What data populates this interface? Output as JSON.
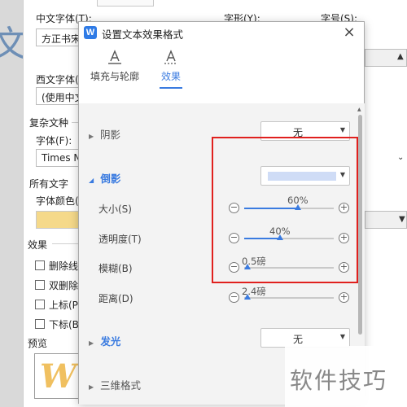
{
  "background_dialog": {
    "chinese_font_label": "中文字体(T):",
    "chinese_font_value": "方正书宋",
    "style_label": "字形(Y):",
    "size_label": "字号(S):",
    "western_font_label": "西文字体(X):",
    "western_font_value": "(使用中文",
    "complex_script_label": "复杂文种",
    "font_label": "字体(F):",
    "font_value": "Times N",
    "all_text_label": "所有文字",
    "font_color_label": "字体颜色(",
    "effects_label": "效果",
    "effects": [
      "删除线",
      "双删除",
      "上标(P",
      "下标(B"
    ],
    "preview_label": "预览",
    "preview_text": "W",
    "left_char": "文"
  },
  "dialog": {
    "title": "设置文本效果格式",
    "app_icon_letter": "W",
    "close_glyph": "×",
    "tabs": [
      {
        "label": "填充与轮廓",
        "icon": "text-fill-outline-icon"
      },
      {
        "label": "效果",
        "icon": "text-effect-icon",
        "active": true
      }
    ],
    "sections": {
      "shadow": {
        "label": "阴影",
        "value": "无"
      },
      "reflection": {
        "label": "倒影",
        "color": "#cfdcf6",
        "params": [
          {
            "label": "大小(S)",
            "value": "60%",
            "level": 0.6
          },
          {
            "label": "透明度(T)",
            "value": "40%",
            "level": 0.4
          },
          {
            "label": "模糊(B)",
            "value": "0.5磅",
            "level": 0.0
          },
          {
            "label": "距离(D)",
            "value": "2.4磅",
            "level": 0.0
          }
        ]
      },
      "glow": {
        "label": "发光",
        "value": "无"
      },
      "three_d": {
        "label": "三维格式"
      }
    }
  },
  "watermark": "软件技巧",
  "colors": {
    "accent": "#3a7be0",
    "highlight": "#e0201e"
  }
}
